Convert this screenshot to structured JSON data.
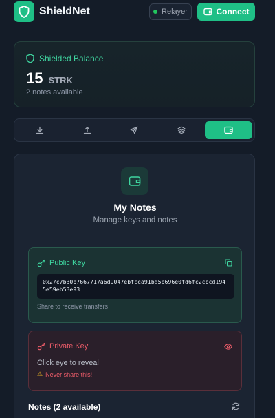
{
  "header": {
    "brand": "ShieldNet",
    "relayer_label": "Relayer",
    "connect_label": "Connect"
  },
  "balance": {
    "title": "Shielded Balance",
    "amount": "15",
    "unit": "STRK",
    "notes_available": "2 notes available"
  },
  "tabs": [
    {
      "icon": "download-icon",
      "active": false
    },
    {
      "icon": "upload-icon",
      "active": false
    },
    {
      "icon": "send-icon",
      "active": false
    },
    {
      "icon": "layers-icon",
      "active": false
    },
    {
      "icon": "wallet-icon",
      "active": true
    }
  ],
  "notes_panel": {
    "title": "My Notes",
    "subtitle": "Manage keys and notes",
    "public_key": {
      "label": "Public Key",
      "value": "0x27c7b30b7667717a6d9047ebfcca91bd5b696e0fd6fc2cbcd1945e59eb53e93",
      "hint": "Share to receive transfers"
    },
    "private_key": {
      "label": "Private Key",
      "reveal_text": "Click eye to reveal",
      "warning": "Never share this!"
    },
    "notes_heading": "Notes (2 available)"
  },
  "colors": {
    "accent": "#1fbf86",
    "background": "#141c28",
    "danger": "#ef5d6a"
  }
}
